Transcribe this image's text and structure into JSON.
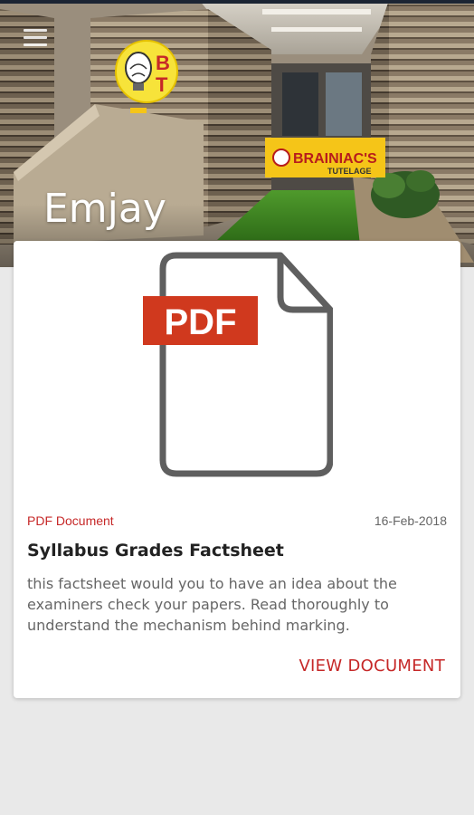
{
  "header": {
    "title": "Emjay",
    "logo_letters": [
      "B",
      "T"
    ],
    "sign_text": "BRAINIAC'S",
    "sign_subtext": "TUTELAGE",
    "menu_icon": "hamburger-icon"
  },
  "document": {
    "icon": "pdf-file-icon",
    "badge_label": "PDF",
    "type_label": "PDF Document",
    "date": "16-Feb-2018",
    "title": "Syllabus Grades Factsheet",
    "description": "this factsheet would you to have an idea about the examiners check your papers. Read thoroughly to understand the mechanism behind marking.",
    "action_label": "VIEW DOCUMENT"
  },
  "colors": {
    "accent": "#c62828",
    "background": "#e9e9e9",
    "card": "#ffffff",
    "title_text": "#222222",
    "body_text": "#666666"
  }
}
